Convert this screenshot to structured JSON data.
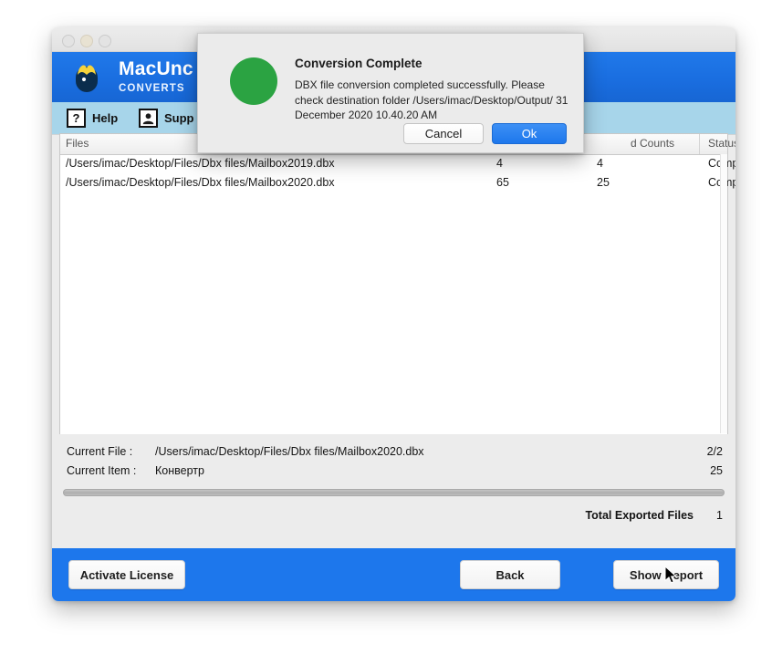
{
  "window": {
    "traffic_lights": [
      "close-button",
      "minimize-button",
      "zoom-button"
    ]
  },
  "brand": {
    "title": "MacUnc",
    "subtitle": "CONVERTS",
    "logo_icon": "app-logo-icon"
  },
  "toolbar": {
    "help": {
      "label": "Help",
      "icon": "question-mark-icon",
      "glyph": "?"
    },
    "support": {
      "label": "Supp",
      "icon": "support-person-icon",
      "glyph": "♟"
    }
  },
  "table": {
    "columns": [
      {
        "key": "files",
        "label": "Files"
      },
      {
        "key": "total_counts",
        "label": ""
      },
      {
        "key": "converted_counts",
        "label": "d Counts"
      },
      {
        "key": "status",
        "label": "Status"
      }
    ],
    "rows": [
      {
        "file": "/Users/imac/Desktop/Files/Dbx files/Mailbox2019.dbx",
        "total": "4",
        "converted": "4",
        "status": "Complete"
      },
      {
        "file": "/Users/imac/Desktop/Files/Dbx files/Mailbox2020.dbx",
        "total": "65",
        "converted": "25",
        "status": "Complete"
      }
    ]
  },
  "status": {
    "current_file_label": "Current File :",
    "current_file_value": "/Users/imac/Desktop/Files/Dbx files/Mailbox2020.dbx",
    "current_file_count": "2/2",
    "current_item_label": "Current Item :",
    "current_item_value": "Конвертр",
    "current_item_count": "25",
    "progress_percent": 100,
    "total_exported_label": "Total Exported Files",
    "total_exported_value": "1"
  },
  "footer": {
    "activate_license": "Activate License",
    "back": "Back",
    "show_report": "Show Report"
  },
  "dialog": {
    "title": "Conversion Complete",
    "message": "DBX file conversion completed successfully. Please check destination folder /Users/imac/Desktop/Output/ 31 December 2020 10.40.20 AM",
    "status_icon": "green-success-circle-icon",
    "cancel_label": "Cancel",
    "ok_label": "Ok"
  },
  "colors": {
    "brand_blue": "#1d77ec",
    "toolbar_band": "#a7d5ea",
    "success_green": "#2ba342",
    "panel_gray": "#ececec"
  },
  "cursor": {
    "icon": "mouse-pointer-icon"
  }
}
